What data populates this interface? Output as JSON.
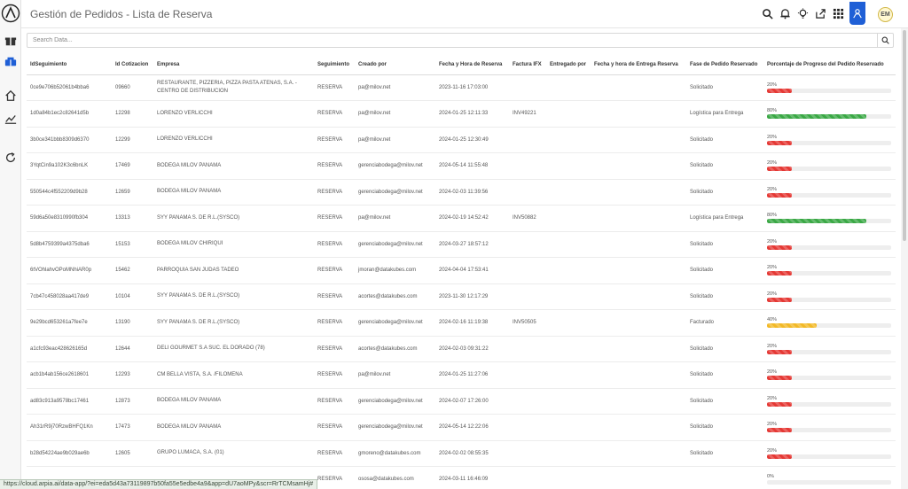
{
  "header": {
    "title": "Gestión de Pedidos - Lista de Reserva",
    "avatar_initials": "EM"
  },
  "search": {
    "placeholder": "Search Data..."
  },
  "statusbar": {
    "url": "https://cloud.arpia.ai/data-app/?ei=eda5d43a73119897b50fa55e5edbe4a9&app=dU7aoMPy&scr=RrTCMsamHj#"
  },
  "colors": {
    "accent": "#1f5fd6",
    "green": "#3aa845",
    "red": "#e53935",
    "yellow": "#f2b927"
  },
  "table": {
    "columns": [
      "IdSeguimiento",
      "Id Cotizacion",
      "Empresa",
      "Seguimiento",
      "Creado por",
      "Fecha y Hora de Reserva",
      "Factura IFX",
      "Entregado por",
      "Fecha y hora de Entrega Reserva",
      "Fase de Pedido Reservado",
      "Porcentaje de Progreso del Pedido Reservado"
    ],
    "rows": [
      {
        "id": "0ce9e706b52061b4bba6",
        "cot": "09660",
        "empresa": "RESTAURANTE, PIZZERIA, PIZZA PASTA ATENAS, S.A. - CENTRO DE DISTRIBUCION",
        "seg": "RESERVA",
        "creado": "pa@milov.net",
        "fecha": "2023-11-16 17:03:00",
        "factura": "",
        "entregado": "",
        "fecha_entrega": "",
        "fase": "Solicitado",
        "pct": "20%",
        "progress": 0.2,
        "color": "#e53935"
      },
      {
        "id": "1d0a84b1ec2c82641d5b",
        "cot": "12298",
        "empresa": "LORENZO VERLICCHI",
        "seg": "RESERVA",
        "creado": "pa@milov.net",
        "fecha": "2024-01-25 12:11:33",
        "factura": "INV49221",
        "entregado": "",
        "fecha_entrega": "",
        "fase": "Logística para Entrega",
        "pct": "80%",
        "progress": 0.8,
        "color": "#3aa845"
      },
      {
        "id": "3b0ce341bbb8309d6370",
        "cot": "12299",
        "empresa": "LORENZO VERLICCHI",
        "seg": "RESERVA",
        "creado": "pa@milov.net",
        "fecha": "2024-01-25 12:30:49",
        "factura": "",
        "entregado": "",
        "fecha_entrega": "",
        "fase": "Solicitado",
        "pct": "20%",
        "progress": 0.2,
        "color": "#e53935"
      },
      {
        "id": "3YqtCin9a102K3c6bnLK",
        "cot": "17469",
        "empresa": "BODEGA MILOV PANAMA",
        "seg": "RESERVA",
        "creado": "gerenciabodega@milov.net",
        "fecha": "2024-05-14 11:55:48",
        "factura": "",
        "entregado": "",
        "fecha_entrega": "",
        "fase": "Solicitado",
        "pct": "20%",
        "progress": 0.2,
        "color": "#e53935"
      },
      {
        "id": "550544c4f552209d9b28",
        "cot": "12659",
        "empresa": "BODEGA MILOV PANAMA",
        "seg": "RESERVA",
        "creado": "gerenciabodega@milov.net",
        "fecha": "2024-02-03 11:39:56",
        "factura": "",
        "entregado": "",
        "fecha_entrega": "",
        "fase": "Solicitado",
        "pct": "20%",
        "progress": 0.2,
        "color": "#e53935"
      },
      {
        "id": "59d6a50e8310990fb304",
        "cot": "13313",
        "empresa": "SYY PANAMA S. DE R.L.(SYSCO)",
        "seg": "RESERVA",
        "creado": "pa@milov.net",
        "fecha": "2024-02-19 14:52:42",
        "factura": "INV50882",
        "entregado": "",
        "fecha_entrega": "",
        "fase": "Logística para Entrega",
        "pct": "80%",
        "progress": 0.8,
        "color": "#3aa845"
      },
      {
        "id": "5d8b4759399a4375dba6",
        "cot": "15153",
        "empresa": "BODEGA MILOV CHIRIQUI",
        "seg": "RESERVA",
        "creado": "gerenciabodega@milov.net",
        "fecha": "2024-03-27 18:57:12",
        "factura": "",
        "entregado": "",
        "fecha_entrega": "",
        "fase": "Solicitado",
        "pct": "20%",
        "progress": 0.2,
        "color": "#e53935"
      },
      {
        "id": "6tVOhlahvOPoMNhiAR0p",
        "cot": "15462",
        "empresa": "PARROQUIA SAN JUDAS TADEO",
        "seg": "RESERVA",
        "creado": "jmoran@datakubes.com",
        "fecha": "2024-04-04 17:53:41",
        "factura": "",
        "entregado": "",
        "fecha_entrega": "",
        "fase": "Solicitado",
        "pct": "20%",
        "progress": 0.2,
        "color": "#e53935"
      },
      {
        "id": "7cb47c458028aa417de9",
        "cot": "10104",
        "empresa": "SYY PANAMA S. DE R.L.(SYSCO)",
        "seg": "RESERVA",
        "creado": "acortes@datakubes.com",
        "fecha": "2023-11-30 12:17:29",
        "factura": "",
        "entregado": "",
        "fecha_entrega": "",
        "fase": "Solicitado",
        "pct": "20%",
        "progress": 0.2,
        "color": "#e53935"
      },
      {
        "id": "9e29bcd653261a7fee7e",
        "cot": "13190",
        "empresa": "SYY PANAMA S. DE R.L.(SYSCO)",
        "seg": "RESERVA",
        "creado": "gerenciabodega@milov.net",
        "fecha": "2024-02-16 11:19:38",
        "factura": "INV50505",
        "entregado": "",
        "fecha_entrega": "",
        "fase": "Facturado",
        "pct": "40%",
        "progress": 0.4,
        "color": "#f2b927"
      },
      {
        "id": "a1cfc93eac428626165d",
        "cot": "12644",
        "empresa": "DELI GOURMET S.A SUC. EL DORADO (78)",
        "seg": "RESERVA",
        "creado": "acortes@datakubes.com",
        "fecha": "2024-02-03 09:31:22",
        "factura": "",
        "entregado": "",
        "fecha_entrega": "",
        "fase": "Solicitado",
        "pct": "20%",
        "progress": 0.2,
        "color": "#e53935"
      },
      {
        "id": "acb1b4ab156ce2618601",
        "cot": "12293",
        "empresa": "CM BELLA VISTA, S.A. /FILOMENA",
        "seg": "RESERVA",
        "creado": "pa@milov.net",
        "fecha": "2024-01-25 11:27:06",
        "factura": "",
        "entregado": "",
        "fecha_entrega": "",
        "fase": "Solicitado",
        "pct": "20%",
        "progress": 0.2,
        "color": "#e53935"
      },
      {
        "id": "ad83c913a9578bc17461",
        "cot": "12873",
        "empresa": "BODEGA MILOV PANAMA",
        "seg": "RESERVA",
        "creado": "gerenciabodega@milov.net",
        "fecha": "2024-02-07 17:26:00",
        "factura": "",
        "entregado": "",
        "fecha_entrega": "",
        "fase": "Solicitado",
        "pct": "20%",
        "progress": 0.2,
        "color": "#e53935"
      },
      {
        "id": "Ah31rR9j70RzwBHFQ1Kn",
        "cot": "17473",
        "empresa": "BODEGA MILOV PANAMA",
        "seg": "RESERVA",
        "creado": "gerenciabodega@milov.net",
        "fecha": "2024-05-14 12:22:06",
        "factura": "",
        "entregado": "",
        "fecha_entrega": "",
        "fase": "Solicitado",
        "pct": "20%",
        "progress": 0.2,
        "color": "#e53935"
      },
      {
        "id": "b28d54224ae9b029ae6b",
        "cot": "12605",
        "empresa": "GRUPO LUMACA, S.A. (01)",
        "seg": "RESERVA",
        "creado": "gmoreno@datakubes.com",
        "fecha": "2024-02-02 08:55:35",
        "factura": "",
        "entregado": "",
        "fecha_entrega": "",
        "fase": "Solicitado",
        "pct": "20%",
        "progress": 0.2,
        "color": "#e53935"
      },
      {
        "id": "",
        "cot": "",
        "empresa": "",
        "seg": "RESERVA",
        "creado": "ososa@datakubes.com",
        "fecha": "2024-03-11 16:46:09",
        "factura": "",
        "entregado": "",
        "fecha_entrega": "",
        "fase": "",
        "pct": "0%",
        "progress": 0,
        "color": "#e53935"
      }
    ]
  }
}
